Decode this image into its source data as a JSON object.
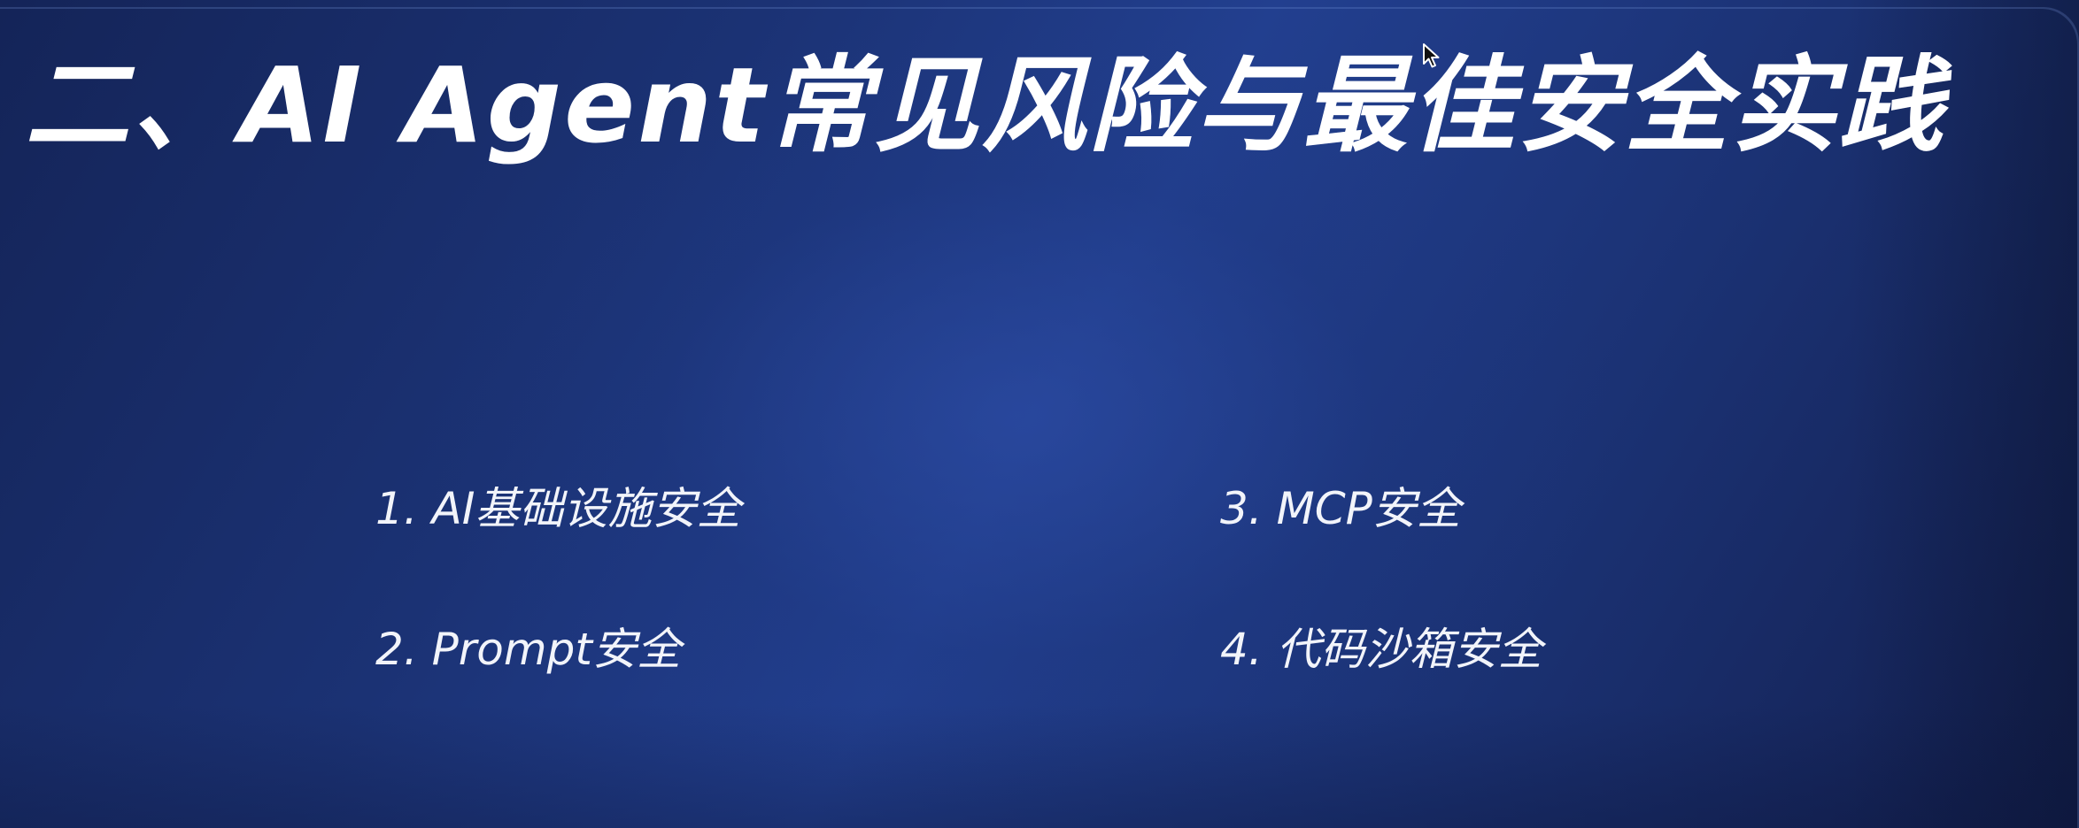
{
  "slide": {
    "title": "二、AI Agent常见风险与最佳安全实践",
    "items": [
      {
        "label": "1. AI基础设施安全"
      },
      {
        "label": "2. Prompt安全"
      },
      {
        "label": "3. MCP安全"
      },
      {
        "label": "4. 代码沙箱安全"
      }
    ]
  },
  "colors": {
    "background": "#1b3274",
    "text": "#ffffff"
  },
  "icons": {
    "cursor": "mouse-pointer-icon"
  }
}
